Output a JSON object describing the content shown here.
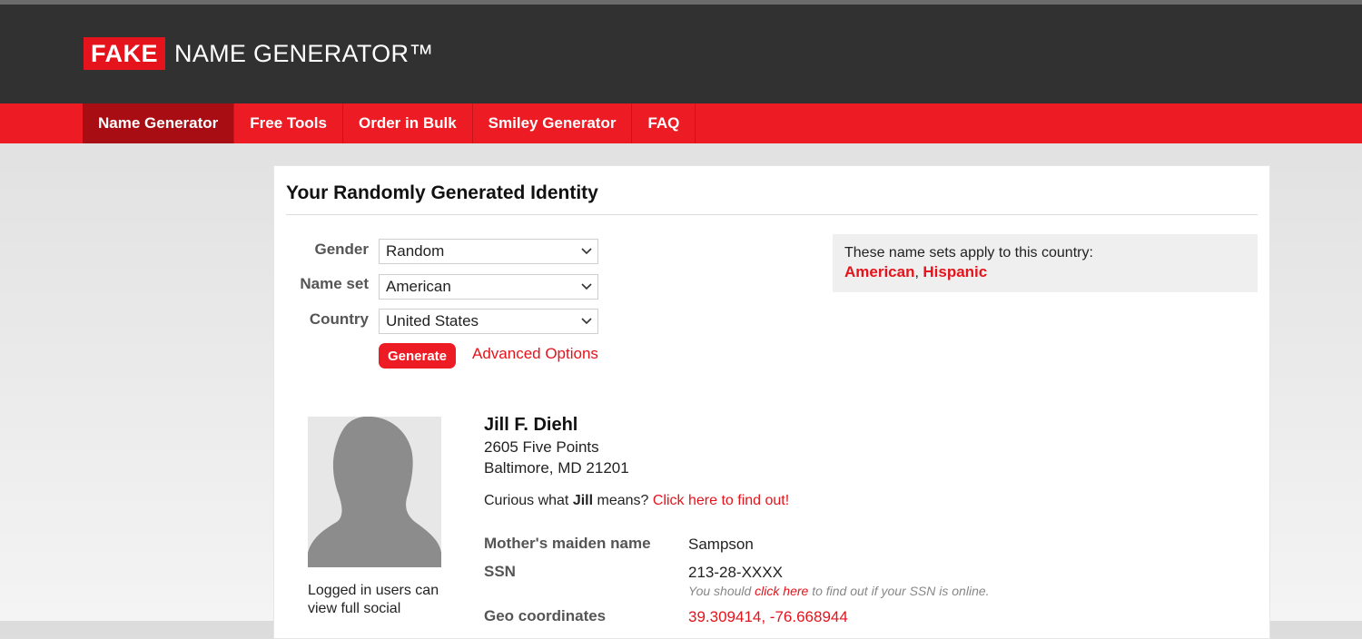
{
  "brand": {
    "box": "FAKE",
    "rest": "NAME GENERATOR™"
  },
  "nav": {
    "items": [
      "Name Generator",
      "Free Tools",
      "Order in Bulk",
      "Smiley Generator",
      "FAQ"
    ],
    "active": "Name Generator"
  },
  "main": {
    "title": "Your Randomly Generated Identity",
    "form": {
      "gender_label": "Gender",
      "gender_value": "Random",
      "nameset_label": "Name set",
      "nameset_value": "American",
      "country_label": "Country",
      "country_value": "United States",
      "generate_label": "Generate",
      "advanced_label": "Advanced Options"
    },
    "namesets_box": {
      "text": "These name sets apply to this country:",
      "sets": [
        "American",
        "Hispanic"
      ],
      "separator": ", "
    },
    "identity": {
      "name": "Jill F. Diehl",
      "address_line1": "2605 Five Points",
      "address_line2": "Baltimore, MD 21201",
      "curious_prefix": "Curious what ",
      "first_name": "Jill",
      "curious_suffix": " means? ",
      "curious_link": "Click here to find out!",
      "login_note": "Logged in users can view full social",
      "details": {
        "maiden_label": "Mother's maiden name",
        "maiden_value": "Sampson",
        "ssn_label": "SSN",
        "ssn_value": "213-28-XXXX",
        "ssn_note_prefix": "You should ",
        "ssn_note_link": "click here",
        "ssn_note_suffix": " to find out if your SSN is online.",
        "geo_label": "Geo coordinates",
        "geo_value": "39.309414, -76.668944"
      }
    }
  },
  "colors": {
    "brand_red": "#ed1c24",
    "nav_active": "#a70d12",
    "header": "#313131",
    "link": "#e5131b"
  },
  "icons": {
    "select_arrow": "chevron-down-icon",
    "avatar": "person-silhouette-icon"
  }
}
